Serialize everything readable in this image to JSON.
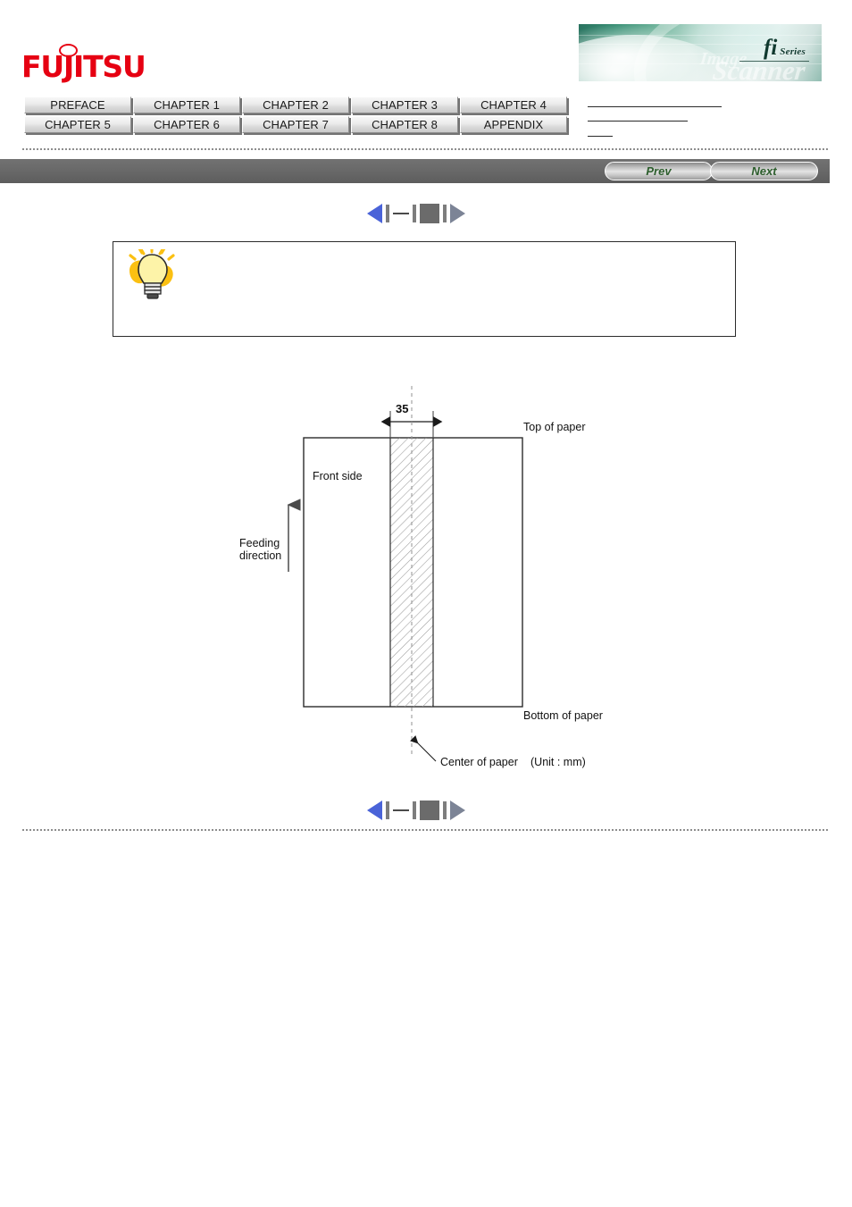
{
  "brand": {
    "logo_text": "FUJITSU",
    "banner": {
      "fi_mark": "fi",
      "series_word": "Series",
      "ghost_image": "Image",
      "ghost_scanner": "Scanner"
    }
  },
  "chapter_tabs": [
    {
      "label": "PREFACE"
    },
    {
      "label": "CHAPTER 1"
    },
    {
      "label": "CHAPTER 2"
    },
    {
      "label": "CHAPTER 3"
    },
    {
      "label": "CHAPTER 4"
    },
    {
      "label": "CHAPTER 5"
    },
    {
      "label": "CHAPTER 6"
    },
    {
      "label": "CHAPTER 7"
    },
    {
      "label": "CHAPTER 8"
    },
    {
      "label": "APPENDIX"
    }
  ],
  "nav_bar": {
    "prev_label": "Prev",
    "next_label": "Next"
  },
  "hint_box": {
    "icon": "lightbulb-icon",
    "text": ""
  },
  "diagram": {
    "title": "",
    "dimension_value": "35",
    "labels": {
      "top_of_paper": "Top of paper",
      "bottom_of_paper": "Bottom of paper",
      "front_side": "Front side",
      "feeding_direction_line1": "Feeding",
      "feeding_direction_line2": "direction",
      "center_of_paper": "Center of paper",
      "unit_note": "(Unit : mm)"
    }
  },
  "colors": {
    "brand_red": "#e60012",
    "nav_bar_gray": "#676767",
    "pill_text_green": "#2d5e2d",
    "stepper_active_blue": "#4a63d8",
    "stepper_inactive_gray": "#7c8496",
    "bulb_yellow": "#ffd633"
  }
}
